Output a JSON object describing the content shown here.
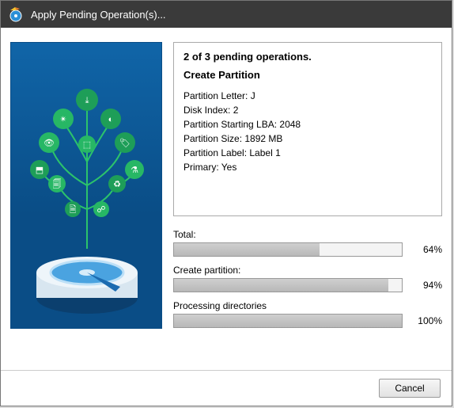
{
  "titlebar": {
    "title": "Apply Pending Operation(s)..."
  },
  "operation": {
    "header": "2 of 3 pending operations.",
    "name": "Create Partition",
    "details": {
      "partition_letter": "Partition Letter: J",
      "disk_index": "Disk Index: 2",
      "starting_lba": "Partition Starting LBA: 2048",
      "size": "Partition Size: 1892 MB",
      "label": "Partition Label: Label 1",
      "primary": "Primary: Yes"
    }
  },
  "progress": {
    "total": {
      "label": "Total:",
      "percent": 64,
      "text": "64%"
    },
    "create": {
      "label": "Create partition:",
      "percent": 94,
      "text": "94%"
    },
    "processing": {
      "label": "Processing directories",
      "percent": 100,
      "text": "100%"
    }
  },
  "footer": {
    "cancel_label": "Cancel"
  },
  "colors": {
    "titlebar_bg": "#3a3a3a",
    "sidebar_bg_top": "#1065a8",
    "tree_green": "#2cc36b",
    "progress_fill": "#bfbfbf"
  }
}
